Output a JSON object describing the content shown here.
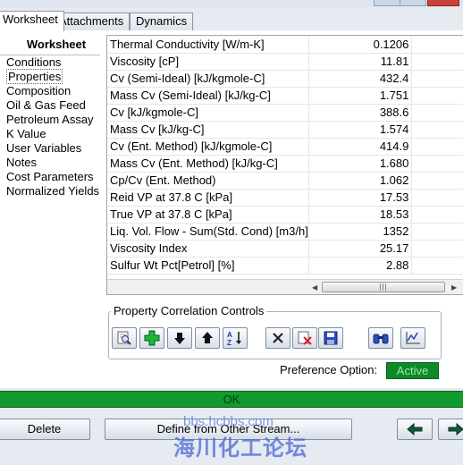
{
  "tabs": [
    {
      "label": "Worksheet",
      "active": true
    },
    {
      "label": "Attachments",
      "active": false
    },
    {
      "label": "Dynamics",
      "active": false
    }
  ],
  "nav": {
    "title": "Worksheet",
    "items": [
      {
        "label": "Conditions"
      },
      {
        "label": "Properties",
        "selected": true
      },
      {
        "label": "Composition"
      },
      {
        "label": "Oil & Gas Feed"
      },
      {
        "label": "Petroleum Assay"
      },
      {
        "label": "K Value"
      },
      {
        "label": "User Variables"
      },
      {
        "label": "Notes"
      },
      {
        "label": "Cost Parameters"
      },
      {
        "label": "Normalized Yields"
      }
    ]
  },
  "properties": {
    "rows": [
      {
        "label": "Thermal Conductivity [W/m-K]",
        "value": "0.1206"
      },
      {
        "label": "Viscosity [cP]",
        "value": "11.81"
      },
      {
        "label": "Cv (Semi-Ideal) [kJ/kgmole-C]",
        "value": "432.4"
      },
      {
        "label": "Mass Cv (Semi-Ideal) [kJ/kg-C]",
        "value": "1.751"
      },
      {
        "label": "Cv [kJ/kgmole-C]",
        "value": "388.6"
      },
      {
        "label": "Mass Cv [kJ/kg-C]",
        "value": "1.574"
      },
      {
        "label": "Cv (Ent. Method) [kJ/kgmole-C]",
        "value": "414.9"
      },
      {
        "label": "Mass Cv (Ent. Method) [kJ/kg-C]",
        "value": "1.680"
      },
      {
        "label": "Cp/Cv (Ent. Method)",
        "value": "1.062"
      },
      {
        "label": "Reid VP at 37.8 C [kPa]",
        "value": "17.53"
      },
      {
        "label": "True VP at 37.8 C [kPa]",
        "value": "18.53"
      },
      {
        "label": "Liq. Vol. Flow - Sum(Std. Cond) [m3/h]",
        "value": "1352"
      },
      {
        "label": "Viscosity Index",
        "value": "25.17"
      },
      {
        "label": "Sulfur Wt Pct[Petrol] [%]",
        "value": "2.88"
      }
    ]
  },
  "correlation": {
    "title": "Property Correlation Controls"
  },
  "preference": {
    "label": "Preference Option:",
    "value": "Active"
  },
  "status": {
    "text": "OK"
  },
  "buttons": {
    "delete": "Delete",
    "define_from_other": "Define from Other Stream..."
  },
  "watermark": {
    "url": "bbs.hcbbs.com",
    "text": "海川化工论坛"
  },
  "colors": {
    "status_green": "#119a2e",
    "active_green": "#0b8a2a"
  }
}
